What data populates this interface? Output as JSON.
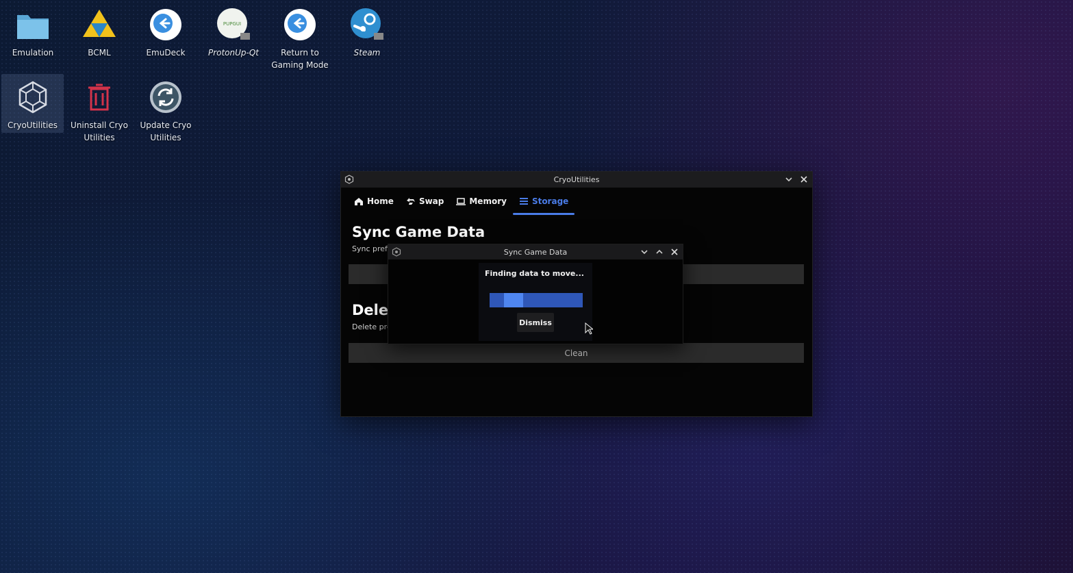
{
  "desktop": {
    "icons": [
      {
        "label": "Emulation",
        "icon": "folder-icon"
      },
      {
        "label": "BCML",
        "icon": "triforce-icon"
      },
      {
        "label": "EmuDeck",
        "icon": "emudeck-icon"
      },
      {
        "label": "ProtonUp-Qt",
        "icon": "protonup-icon"
      },
      {
        "label": "Return to Gaming Mode",
        "label_line1": "Return to",
        "label_line2": "Gaming Mode",
        "icon": "return-icon"
      },
      {
        "label": "Steam",
        "icon": "steam-icon"
      },
      {
        "label": "CryoUtilities",
        "icon": "cryo-hex-icon"
      },
      {
        "label": "Uninstall Cryo Utilities",
        "label_line1": "Uninstall Cryo",
        "label_line2": "Utilities",
        "icon": "trash-icon"
      },
      {
        "label": "Update Cryo Utilities",
        "label_line1": "Update Cryo",
        "label_line2": "Utilities",
        "icon": "refresh-icon"
      }
    ],
    "badges": {
      "protonup": "PUPGUI"
    }
  },
  "app": {
    "title": "CryoUtilities",
    "tabs": [
      {
        "label": "Home",
        "icon": "home-icon"
      },
      {
        "label": "Swap",
        "icon": "swap-icon"
      },
      {
        "label": "Memory",
        "icon": "memory-icon"
      },
      {
        "label": "Storage",
        "icon": "storage-icon",
        "active": true
      }
    ],
    "sync_section": {
      "heading": "Sync Game Data",
      "description": "Sync prefix"
    },
    "delete_section": {
      "heading": "Delet",
      "description": "Delete pre",
      "button": "Clean"
    }
  },
  "dialog": {
    "title": "Sync Game Data",
    "status": "Finding data to move...",
    "dismiss_label": "Dismiss"
  },
  "colors": {
    "accent": "#4a7ce8",
    "progress": "#2f57b8",
    "progress_chunk": "#4f86f0"
  }
}
